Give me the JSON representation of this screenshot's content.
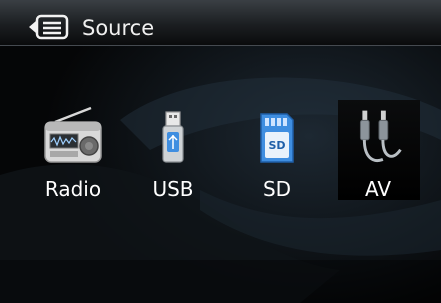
{
  "header": {
    "title": "Source",
    "icon": "source-list-icon"
  },
  "sources": [
    {
      "label": "Radio",
      "icon": "radio-icon"
    },
    {
      "label": "USB",
      "icon": "usb-drive-icon"
    },
    {
      "label": "SD",
      "icon": "sd-card-icon"
    },
    {
      "label": "AV",
      "icon": "av-cable-icon",
      "selected": true
    }
  ],
  "colors": {
    "background": "#060708",
    "header_top": "#3a3f44",
    "text": "#ffffff",
    "sd_blue": "#3f8ee0"
  }
}
